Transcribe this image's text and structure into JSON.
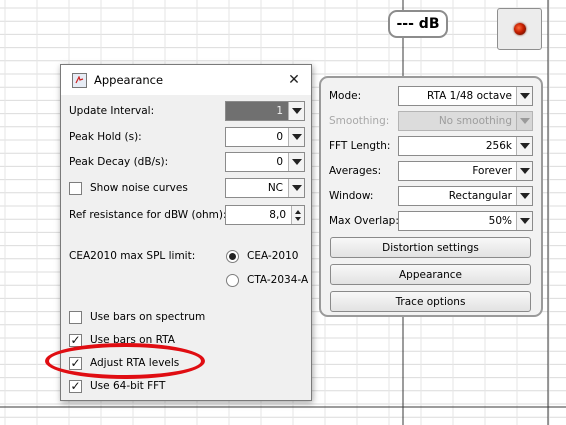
{
  "readout": {
    "level": "--- dB"
  },
  "led_button": {
    "state_color": "#c41e00"
  },
  "settings": {
    "mode": {
      "label": "Mode:",
      "value": "RTA 1/48 octave"
    },
    "smoothing": {
      "label": "Smoothing:",
      "value": "No  smoothing",
      "enabled": false
    },
    "fft_length": {
      "label": "FFT Length:",
      "value": "256k"
    },
    "averages": {
      "label": "Averages:",
      "value": "Forever"
    },
    "window": {
      "label": "Window:",
      "value": "Rectangular"
    },
    "max_overlap": {
      "label": "Max Overlap:",
      "value": "50%"
    },
    "buttons": {
      "distortion": "Distortion settings",
      "appearance": "Appearance",
      "trace_options": "Trace options"
    }
  },
  "dialog": {
    "title": "Appearance",
    "update_interval": {
      "label": "Update Interval:",
      "value": "1"
    },
    "peak_hold": {
      "label": "Peak Hold (s):",
      "value": "0"
    },
    "peak_decay": {
      "label": "Peak Decay (dB/s):",
      "value": "0"
    },
    "noise_curves": {
      "label": "Show noise curves",
      "checked": false,
      "value": "NC"
    },
    "ref_resistance": {
      "label": "Ref resistance for dBW (ohm):",
      "value": "8,0"
    },
    "spl_limit": {
      "label": "CEA2010 max SPL limit:",
      "options": [
        {
          "label": "CEA-2010",
          "selected": true
        },
        {
          "label": "CTA-2034-A",
          "selected": false
        }
      ]
    },
    "checkboxes": [
      {
        "label": "Use bars on spectrum",
        "checked": false
      },
      {
        "label": "Use bars on RTA",
        "checked": true
      },
      {
        "label": "Adjust RTA levels",
        "checked": true
      },
      {
        "label": "Use 64-bit FFT",
        "checked": true
      }
    ]
  },
  "annotation_color": "#e00d12"
}
